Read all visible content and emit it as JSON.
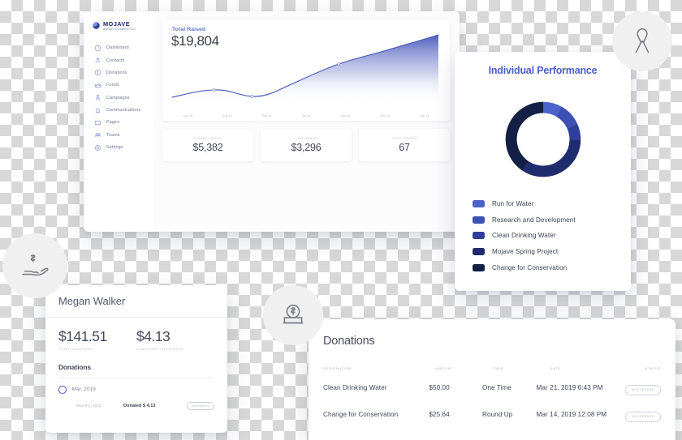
{
  "brand": {
    "name": "MOJAVE",
    "tagline": "WATER CONSERVATION",
    "accent": "#4a5fc6",
    "navy": "#1d2b6b"
  },
  "dashboard": {
    "sidebar": {
      "items": [
        {
          "label": "Dashboard",
          "icon": "gauge-icon"
        },
        {
          "label": "Contacts",
          "icon": "contacts-icon"
        },
        {
          "label": "Donations",
          "icon": "donations-icon"
        },
        {
          "label": "Funds",
          "icon": "funds-icon"
        },
        {
          "label": "Campaigns",
          "icon": "campaigns-icon"
        },
        {
          "label": "Communications",
          "icon": "bell-icon"
        },
        {
          "label": "Pages",
          "icon": "pages-icon"
        },
        {
          "label": "Teams",
          "icon": "teams-icon"
        },
        {
          "label": "Settings",
          "icon": "gear-icon"
        }
      ]
    },
    "total_raised": {
      "label": "Total Raised",
      "value": "$19,804"
    },
    "stats": [
      {
        "label": "CURRENT MONTH",
        "value": "$5,382"
      },
      {
        "label": "LAST MONTH",
        "value": "$3,296"
      },
      {
        "label": "TOTAL DONORS",
        "value": "67"
      }
    ]
  },
  "performance": {
    "title": "Individual Performance",
    "legend": [
      {
        "label": "Run for Water",
        "color": "#4a63c8"
      },
      {
        "label": "Research and Development",
        "color": "#3d51b5"
      },
      {
        "label": "Clean Drinking Water",
        "color": "#2f409c"
      },
      {
        "label": "Mojave Spring Project",
        "color": "#1f2c6e"
      },
      {
        "label": "Change for Conservation",
        "color": "#141f45"
      }
    ]
  },
  "megan": {
    "name": "Megan Walker",
    "stats": [
      {
        "value": "$141.51",
        "label": "TOTAL DONATIONS"
      },
      {
        "value": "$4.13",
        "label": "DONATIONS THIS MONTH"
      }
    ],
    "section_title": "Donations",
    "group_label": "Mar, 2019",
    "entry": {
      "date": "March 1, 2019",
      "amount": "Donated $ 4.13",
      "tag": "ROUNDUPS"
    }
  },
  "donations": {
    "title": "Donations",
    "columns": [
      "DESIGNATION",
      "AMOUNT",
      "TYPE",
      "DATE",
      "STATUS"
    ],
    "rows": [
      {
        "designation": "Clean Drinking Water",
        "amount": "$50.00",
        "type": "One Time",
        "date": "Mar 21, 2019  6:43 PM",
        "status": "SUCCEEDED"
      },
      {
        "designation": "Change for Conservation",
        "amount": "$25.64",
        "type": "Round Up",
        "date": "Mar 14, 2019  12:08 PM",
        "status": "SUCCEEDED"
      }
    ]
  },
  "floating_icons": [
    {
      "name": "ribbon-icon"
    },
    {
      "name": "hand-dollar-icon"
    },
    {
      "name": "coin-donation-icon"
    }
  ],
  "chart_data": [
    {
      "type": "area",
      "title": "Total Raised",
      "xlabel": "",
      "ylabel": "",
      "categories": [
        "July 18",
        "Aug 18",
        "Sep 18",
        "Oct 18",
        "Nov 18",
        "Dec 18",
        "Jan 19"
      ],
      "values": [
        2100,
        2600,
        2300,
        5200,
        9600,
        13200,
        19804
      ],
      "ylim": [
        0,
        21000
      ],
      "grid": false,
      "legend": "none",
      "line_color": "#4456b8",
      "fill": "gradient indigo to white"
    },
    {
      "type": "pie",
      "title": "Individual Performance",
      "labels": [
        "Run for Water",
        "Research and Development",
        "Clean Drinking Water",
        "Mojave Spring Project",
        "Change for Conservation"
      ],
      "values": [
        8,
        10,
        7,
        34,
        41
      ],
      "colors": [
        "#4a63c8",
        "#3d51b5",
        "#2f409c",
        "#1f2c6e",
        "#141f45"
      ],
      "legend": "bottom-left",
      "donut": true
    }
  ]
}
